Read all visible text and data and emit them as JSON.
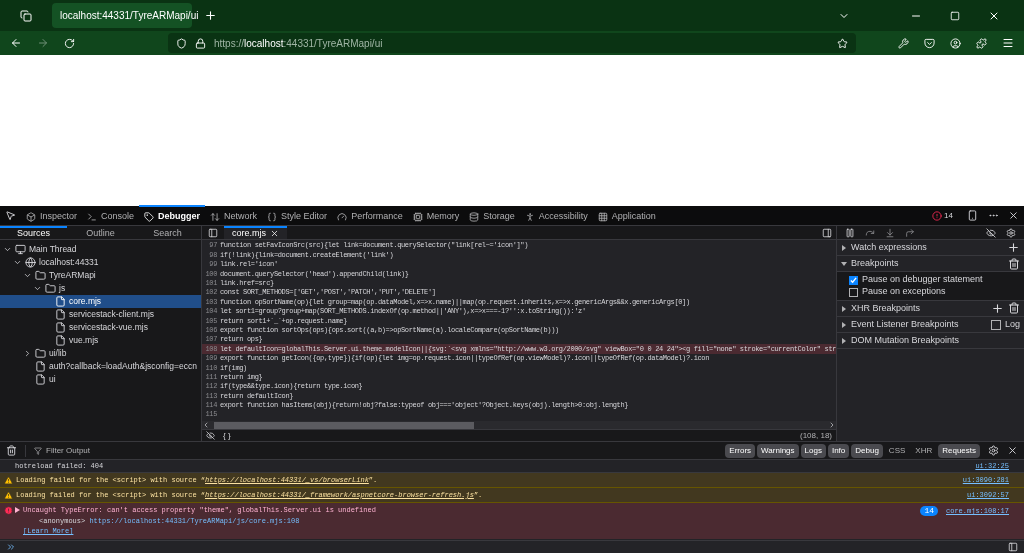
{
  "browser": {
    "tab_title": "localhost:44331/TyreARMapi/ui",
    "url_prefix": "https://",
    "url_host": "localhost",
    "url_rest": ":44331/TyreARMapi/ui"
  },
  "devtools": {
    "tabs": [
      {
        "label": "Inspector",
        "selected": false
      },
      {
        "label": "Console",
        "selected": false
      },
      {
        "label": "Debugger",
        "selected": true
      },
      {
        "label": "Network",
        "selected": false
      },
      {
        "label": "Style Editor",
        "selected": false
      },
      {
        "label": "Performance",
        "selected": false
      },
      {
        "label": "Memory",
        "selected": false
      },
      {
        "label": "Storage",
        "selected": false
      },
      {
        "label": "Accessibility",
        "selected": false
      },
      {
        "label": "Application",
        "selected": false
      }
    ],
    "error_count": "14"
  },
  "sources": {
    "panel_tabs": [
      {
        "label": "Sources",
        "selected": true
      },
      {
        "label": "Outline",
        "selected": false
      },
      {
        "label": "Search",
        "selected": false
      }
    ],
    "tree": [
      {
        "label": "Main Thread",
        "kind": "thread",
        "expanded": true,
        "selected": false,
        "children": [
          {
            "label": "localhost:44331",
            "kind": "host",
            "expanded": true,
            "selected": false,
            "children": [
              {
                "label": "TyreARMapi",
                "kind": "folder",
                "expanded": true,
                "selected": false,
                "children": [
                  {
                    "label": "js",
                    "kind": "folder",
                    "expanded": true,
                    "selected": false,
                    "children": [
                      {
                        "label": "core.mjs",
                        "kind": "file",
                        "selected": true
                      },
                      {
                        "label": "servicestack-client.mjs",
                        "kind": "file",
                        "selected": false
                      },
                      {
                        "label": "servicestack-vue.mjs",
                        "kind": "file",
                        "selected": false
                      },
                      {
                        "label": "vue.mjs",
                        "kind": "file",
                        "selected": false
                      }
                    ]
                  }
                ]
              },
              {
                "label": "ui/lib",
                "kind": "folder",
                "expanded": false,
                "selected": false
              },
              {
                "label": "auth?callback=loadAuth&jsconfig=eccn",
                "kind": "file",
                "selected": false
              },
              {
                "label": "ui",
                "kind": "file",
                "selected": false
              }
            ]
          }
        ]
      }
    ]
  },
  "editor": {
    "file_tab": "core.mjs",
    "lines": [
      {
        "number": "97",
        "text": "function setFavIconSrc(src){let link=document.querySelector(\"link[rel~='icon']\")",
        "highlighted": false
      },
      {
        "number": "98",
        "text": "if(!link){link=document.createElement('link')",
        "highlighted": false
      },
      {
        "number": "99",
        "text": "link.rel='icon'",
        "highlighted": false
      },
      {
        "number": "100",
        "text": "document.querySelector('head').appendChild(link)}",
        "highlighted": false
      },
      {
        "number": "101",
        "text": "link.href=src}",
        "highlighted": false
      },
      {
        "number": "102",
        "text": "const SORT_METHODS=['GET','POST','PATCH','PUT','DELETE']",
        "highlighted": false
      },
      {
        "number": "103",
        "text": "function opSortName(op){let group=map(op.dataModel,x=>x.name)||map(op.request.inherits,x=>x.genericArgs&&x.genericArgs[0])",
        "highlighted": false
      },
      {
        "number": "104",
        "text": "let sort1=group?group+map(SORT_METHODS.indexOf(op.method||'ANY'),x=>x===-1?'':x.toString()):'z'",
        "highlighted": false
      },
      {
        "number": "105",
        "text": "return sort1+`_`+op.request.name}",
        "highlighted": false
      },
      {
        "number": "106",
        "text": "export function sortOps(ops){ops.sort((a,b)=>opSortName(a).localeCompare(opSortName(b)))",
        "highlighted": false
      },
      {
        "number": "107",
        "text": "return ops}",
        "highlighted": false
      },
      {
        "number": "108",
        "text": "let defaultIcon=globalThis.Server.ui.theme.modelIcon||{svg:`<svg xmlns=\"http://www.w3.org/2000/svg\" viewBox=\"0 0 24 24\"><g fill=\"none\" stroke=\"currentColor\" str",
        "highlighted": true
      },
      {
        "number": "109",
        "text": "export function getIcon({op,type}){if(op){let img=op.request.icon||typeOfRef(op.viewModel)?.icon||typeOfRef(op.dataModel)?.icon",
        "highlighted": false
      },
      {
        "number": "110",
        "text": "if(img)",
        "highlighted": false
      },
      {
        "number": "111",
        "text": "return img}",
        "highlighted": false
      },
      {
        "number": "112",
        "text": "if(type&&type.icon){return type.icon}",
        "highlighted": false
      },
      {
        "number": "113",
        "text": "return defaultIcon}",
        "highlighted": false
      },
      {
        "number": "114",
        "text": "export function hasItems(obj){return!obj?false:typeof obj==='object'?Object.keys(obj).length>0:obj.length}",
        "highlighted": false
      },
      {
        "number": "115",
        "highlighted": false
      }
    ],
    "footer_braces": "{ }",
    "cursor_position": "(108, 18)"
  },
  "debugger": {
    "sections": [
      {
        "label": "Watch expressions",
        "expanded": false,
        "kind": "add"
      },
      {
        "label": "Breakpoints",
        "expanded": true,
        "kind": "trash"
      },
      {
        "label": "XHR Breakpoints",
        "expanded": false,
        "kind": "add-trash"
      },
      {
        "label": "Event Listener Breakpoints",
        "expanded": false,
        "kind": "log"
      },
      {
        "label": "DOM Mutation Breakpoints",
        "expanded": false,
        "kind": "plain"
      }
    ],
    "log_label": "Log",
    "log_checked": false,
    "breakpoint_options": [
      {
        "label": "Pause on debugger statement",
        "checked": true
      },
      {
        "label": "Pause on exceptions",
        "checked": false
      }
    ]
  },
  "console": {
    "filter_placeholder": "Filter Output",
    "filters": [
      {
        "label": "Errors",
        "selected": true
      },
      {
        "label": "Warnings",
        "selected": true
      },
      {
        "label": "Logs",
        "selected": true
      },
      {
        "label": "Info",
        "selected": true
      },
      {
        "label": "Debug",
        "selected": true
      },
      {
        "label": "CSS",
        "selected": false
      },
      {
        "label": "XHR",
        "selected": false
      },
      {
        "label": "Requests",
        "selected": true
      }
    ],
    "messages": [
      {
        "kind": "log",
        "text": "hotreload failed: 404",
        "location": "ui:32:25"
      },
      {
        "kind": "warning",
        "before": "Loading failed for the <script> with source “",
        "link": "https://localhost:44331/_vs/browserLink",
        "after": "”.",
        "location": "ui:3090:281"
      },
      {
        "kind": "warning",
        "before": "Loading failed for the <script> with source “",
        "link": "https://localhost:44331/_framework/aspnetcore-browser-refresh.js",
        "after": "”.",
        "location": "ui:3092:57"
      },
      {
        "kind": "error",
        "text": "Uncaught TypeError: can't access property \"theme\", globalThis.Server.ui is undefined",
        "frame": "<anonymous>",
        "frame_url": "https://localhost:44331/TyreARMapi/js/core.mjs:108",
        "learn_more": "[Learn More]",
        "count": "14",
        "location": "core.mjs:108:17"
      }
    ]
  }
}
